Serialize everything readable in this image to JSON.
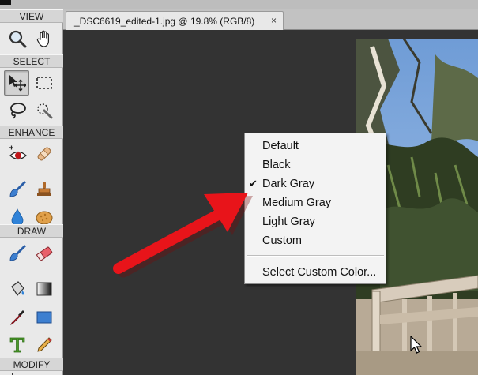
{
  "document_tab": {
    "title": "_DSC6619_edited-1.jpg @ 19.8% (RGB/8)",
    "close_glyph": "×"
  },
  "toolbox": {
    "sections": [
      {
        "label": "VIEW",
        "tools": [
          "zoom-tool-icon",
          "hand-tool-icon"
        ]
      },
      {
        "label": "SELECT",
        "tools": [
          "move-tool-icon",
          "rectangular-marquee-icon",
          "lasso-icon",
          "quick-selection-icon"
        ]
      },
      {
        "label": "ENHANCE",
        "tools": [
          "red-eye-removal-icon",
          "spot-healing-brush-icon",
          "smart-brush-icon",
          "clone-stamp-icon",
          "blur-icon",
          "sponge-icon"
        ]
      },
      {
        "label": "DRAW",
        "tools": [
          "brush-icon",
          "eraser-icon",
          "paint-bucket-icon",
          "gradient-icon",
          "color-picker-icon",
          "shape-icon",
          "type-tool-icon",
          "pencil-icon"
        ]
      },
      {
        "label": "MODIFY",
        "tools": []
      }
    ],
    "active_tool": "move-tool-icon"
  },
  "context_menu": {
    "items": [
      {
        "label": "Default",
        "checked": false
      },
      {
        "label": "Black",
        "checked": false
      },
      {
        "label": "Dark Gray",
        "checked": true
      },
      {
        "label": "Medium Gray",
        "checked": false
      },
      {
        "label": "Light Gray",
        "checked": false
      },
      {
        "label": "Custom",
        "checked": false
      }
    ],
    "check_glyph": "✔",
    "footer_item": "Select Custom Color..."
  },
  "colors": {
    "canvas_background": "#333333",
    "annotation_arrow": "#e8141a",
    "menu_background": "#f3f3f3",
    "toolbox_background": "#e9e9e9"
  }
}
